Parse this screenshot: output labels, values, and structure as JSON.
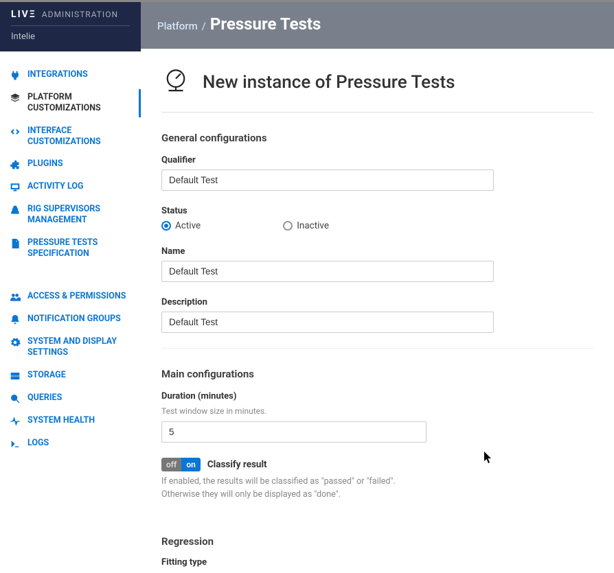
{
  "brand": {
    "live": "LIVΞ",
    "admin": "ADMINISTRATION",
    "company": "Intelie"
  },
  "sidebar": {
    "items": [
      {
        "label": "INTEGRATIONS"
      },
      {
        "label": "PLATFORM CUSTOMIZATIONS"
      },
      {
        "label": "INTERFACE CUSTOMIZATIONS"
      },
      {
        "label": "PLUGINS"
      },
      {
        "label": "ACTIVITY LOG"
      },
      {
        "label": "RIG SUPERVISORS MANAGEMENT"
      },
      {
        "label": "PRESSURE TESTS SPECIFICATION"
      },
      {
        "label": "ACCESS & PERMISSIONS"
      },
      {
        "label": "NOTIFICATION GROUPS"
      },
      {
        "label": "SYSTEM AND DISPLAY SETTINGS"
      },
      {
        "label": "STORAGE"
      },
      {
        "label": "QUERIES"
      },
      {
        "label": "SYSTEM HEALTH"
      },
      {
        "label": "LOGS"
      }
    ]
  },
  "breadcrumb": {
    "root": "Platform",
    "sep": "/",
    "current": "Pressure Tests"
  },
  "page": {
    "title": "New instance of Pressure Tests"
  },
  "general": {
    "section_title": "General configurations",
    "qualifier_label": "Qualifier",
    "qualifier_value": "Default Test",
    "status_label": "Status",
    "status_active": "Active",
    "status_inactive": "Inactive",
    "status_selected": "Active",
    "name_label": "Name",
    "name_value": "Default Test",
    "description_label": "Description",
    "description_value": "Default Test"
  },
  "main_config": {
    "section_title": "Main configurations",
    "duration_label": "Duration (minutes)",
    "duration_help": "Test window size in minutes.",
    "duration_value": "5",
    "classify_toggle_off": "off",
    "classify_toggle_on": "on",
    "classify_label": "Classify result",
    "classify_help": "If enabled, the results will be classified as \"passed\" or \"failed\". Otherwise they will only be displayed as \"done\"."
  },
  "regression": {
    "section_title": "Regression",
    "fitting_label": "Fitting type"
  }
}
